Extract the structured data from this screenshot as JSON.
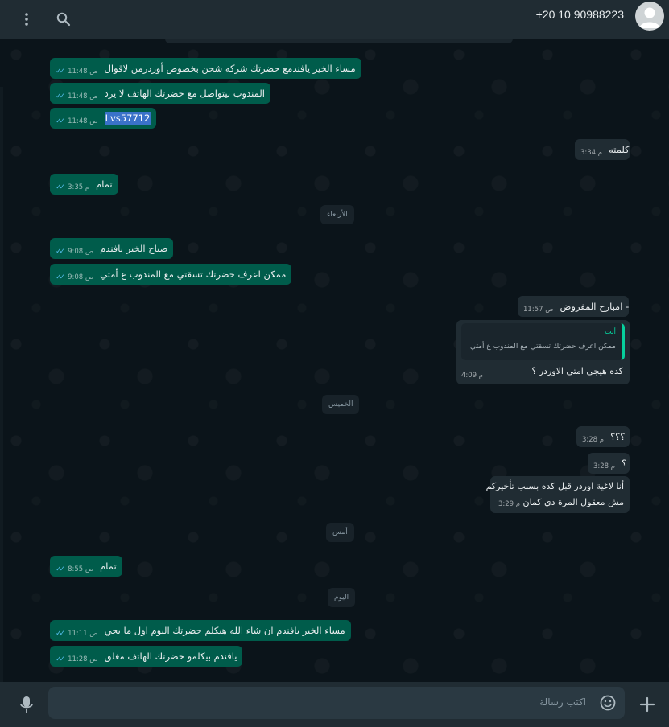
{
  "header": {
    "phone": "+20 10 90988223",
    "icons": [
      "menu-icon",
      "search-icon",
      "avatar"
    ]
  },
  "chips": {
    "wednesday": "الأربعاء",
    "thursday": "الخميس",
    "yesterday": "أمس",
    "today": "اليوم"
  },
  "messages": [
    {
      "text": "مساء الخير يافندمع حضرتك شركه شحن بخصوص أوردرمن لاقوال",
      "time": "11:48 ص"
    },
    {
      "text": "المندوب بيتواصل مع حضرتك الهاتف لا يرد",
      "time": "11:48 ص"
    },
    {
      "text": "Lvs57712",
      "time": "11:48 ص"
    },
    {
      "text": "كلمته",
      "time": "3:34 م"
    },
    {
      "text": "تمام",
      "time": "3:35 م"
    },
    {
      "text": "صباح الخير يافندم",
      "time": "9:08 ص"
    },
    {
      "text": "ممكن اعرف حضرتك تسقتي مع المندوب ع أمتي",
      "time": "9:08 ص"
    },
    {
      "text": "امبارح المفروض -",
      "time": "11:57 ص"
    },
    {
      "quote_author": "أنت",
      "quote_text": "ممكن اعرف حضرتك تسقتي مع المندوب ع أمتي",
      "text": "كده هيجي امتى الاوردر ؟",
      "time": "4:09 م"
    },
    {
      "text": "؟؟؟",
      "time": "3:28 م"
    },
    {
      "text": "؟",
      "time": "3:28 م"
    },
    {
      "line1": "أنا لاغية اوردر قبل كده بسبب تأخيركم",
      "line2": "مش معقول المرة دي كمان",
      "time": "3:29 م"
    },
    {
      "text": "تمام",
      "time": "8:55 ص"
    },
    {
      "text": "مساء الخير يافندم ان شاء الله هيكلم حضرتك اليوم اول ما يجي",
      "time": "11:11 ص"
    },
    {
      "text": "يافندم بيكلمو حضرتك الهاتف مغلق",
      "time": "11:28 ص"
    }
  ],
  "composer": {
    "placeholder": "اكتب رسالة",
    "icons": [
      "mic-icon",
      "emoji-icon",
      "plus-icon"
    ]
  },
  "colors": {
    "outgoing_bubble": "#005c4b",
    "incoming_bubble": "#202c33",
    "background": "#0b141a",
    "read_ticks": "#53bdeb"
  }
}
